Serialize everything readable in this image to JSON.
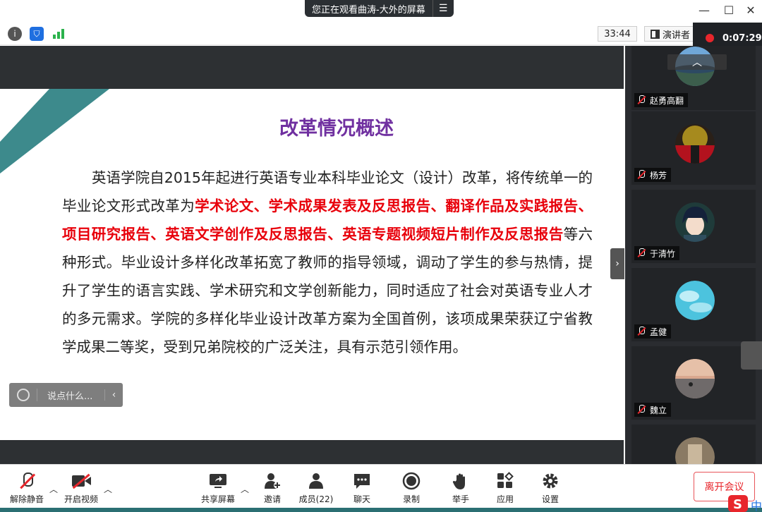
{
  "titlebar": {
    "viewing_text": "您正在观看曲涛-大外的屏幕",
    "menu_icon": "menu-icon",
    "minimize": "—",
    "maximize": "☐",
    "close": "✕"
  },
  "infobar": {
    "timer": "33:44",
    "speaker_view_label": "演讲者",
    "recording_time": "0:07:29"
  },
  "slide": {
    "title": "改革情况概述",
    "body_parts": [
      "英语学院自2015年起进行英语专业本科毕业论文（设计）改革，将传统单一的毕业论文形式改革为",
      "学术论文、学术成果发表及反思报告、翻译作品及实践报告、项目研究报告、英语文学创作及反思报告、英语专题视频短片制作及反思报告",
      "等六种形式。毕业设计多样化改革拓宽了教师的指导领域，调动了学生的参与热情，提升了学生的语言实践、学术研究和文学创新能力，同时适应了社会对英语专业人才的多元需求。学院的多样化毕业设计改革方案为全国首例，该项成果荣获辽宁省教学成果二等奖，受到兄弟院校的广泛关注，具有示范引领作用。"
    ],
    "accent_color": "#7030a0",
    "highlight_color": "#e8000b",
    "stripe_color": "#3d8a8c"
  },
  "chat": {
    "placeholder": "说点什么..."
  },
  "gallery": {
    "participants": [
      {
        "name": "赵勇高翻"
      },
      {
        "name": "杨芳"
      },
      {
        "name": "于清竹"
      },
      {
        "name": "孟健"
      },
      {
        "name": "魏立"
      },
      {
        "name": ""
      }
    ]
  },
  "toolbar": {
    "unmute": "解除静音",
    "start_video": "开启视频",
    "share_screen": "共享屏幕",
    "invite": "邀请",
    "members": "成员(22)",
    "chat": "聊天",
    "record": "录制",
    "raise_hand": "举手",
    "apps": "应用",
    "settings": "设置",
    "leave": "离开会议"
  }
}
